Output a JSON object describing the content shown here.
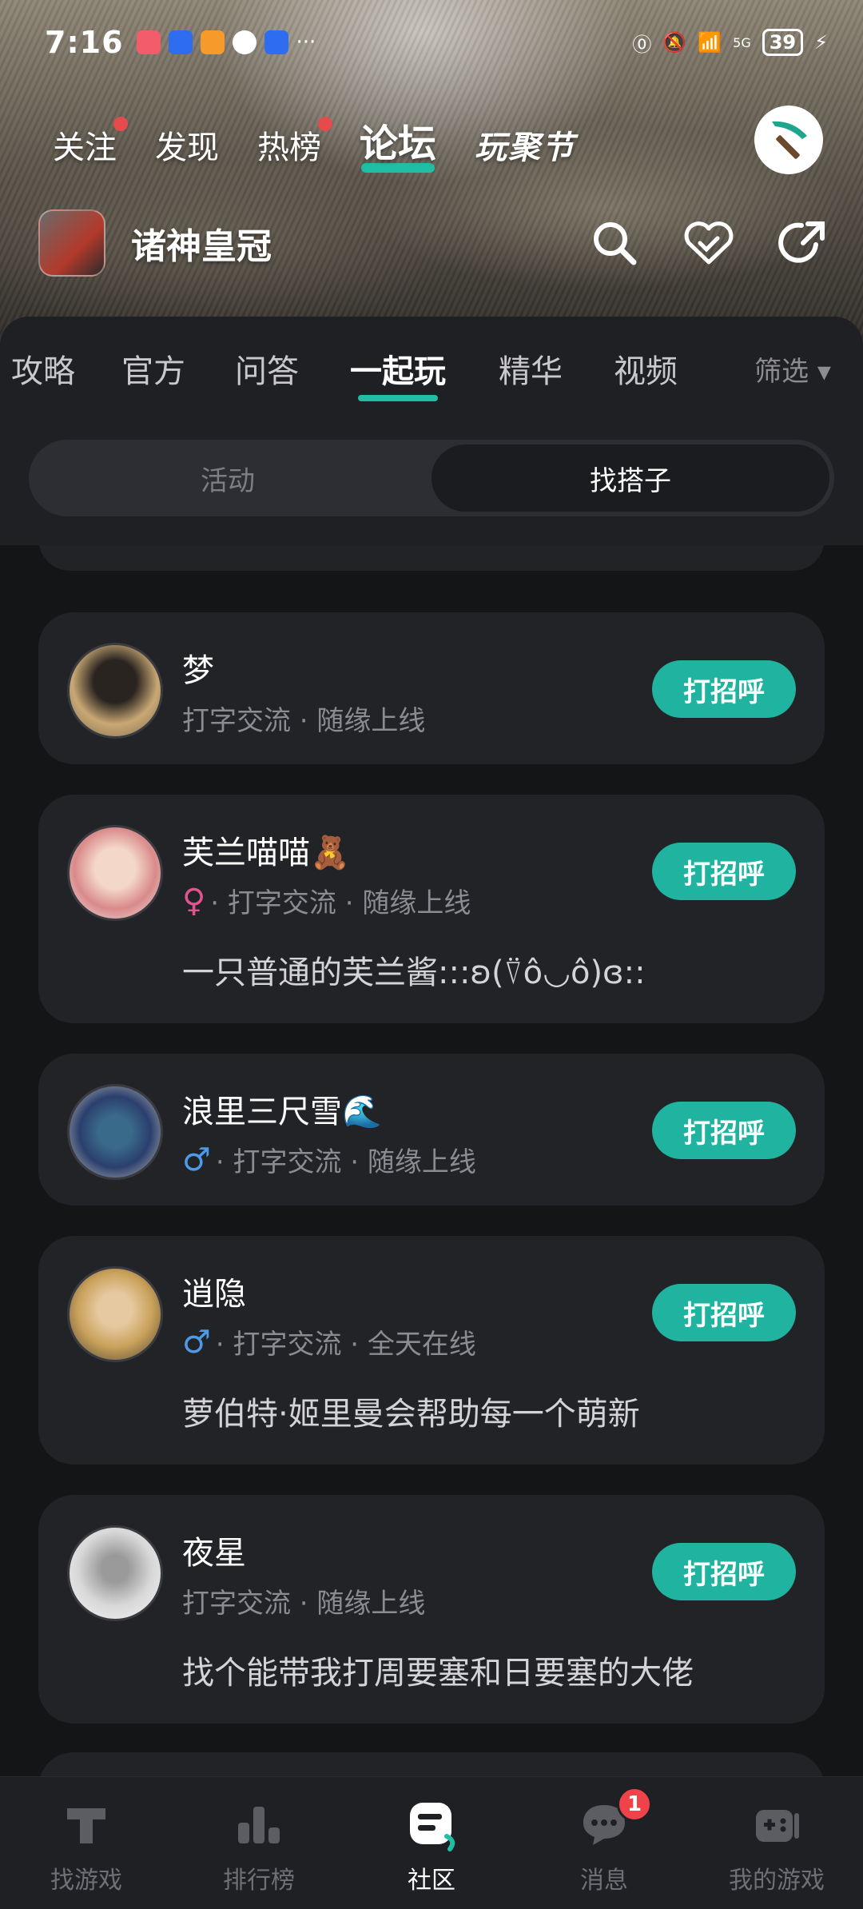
{
  "status_bar": {
    "time": "7:16",
    "battery": "39",
    "network": "5G"
  },
  "top_nav": {
    "items": [
      {
        "label": "关注",
        "dot": true
      },
      {
        "label": "发现",
        "dot": false
      },
      {
        "label": "热榜",
        "dot": true
      },
      {
        "label": "论坛",
        "dot": false,
        "active": true
      }
    ],
    "festival": "玩聚节"
  },
  "game": {
    "name": "诸神皇冠"
  },
  "tabs": {
    "items": [
      "攻略",
      "官方",
      "问答",
      "一起玩",
      "精华",
      "视频"
    ],
    "active": "一起玩",
    "filter": "筛选 ▾"
  },
  "segment": {
    "options": [
      "活动",
      "找搭子"
    ],
    "selected": "找搭子"
  },
  "players": [
    {
      "name": "梦",
      "gender": "",
      "meta": "打字交流 · 随缘上线",
      "bio": "",
      "button": "打招呼"
    },
    {
      "name": "芙兰喵喵🧸",
      "gender": "♀",
      "meta": "· 打字交流 · 随缘上线",
      "bio": "一只普通的芙兰酱:::ʚ(⍢ô◡ô)ɞ::",
      "button": "打招呼"
    },
    {
      "name": "浪里三尺雪🌊",
      "gender": "♂",
      "meta": "· 打字交流 · 随缘上线",
      "bio": "",
      "button": "打招呼"
    },
    {
      "name": "逍隐",
      "gender": "♂",
      "meta": "· 打字交流 · 全天在线",
      "bio": "萝伯特·姬里曼会帮助每一个萌新",
      "button": "打招呼"
    },
    {
      "name": "夜星",
      "gender": "",
      "meta": "打字交流 · 随缘上线",
      "bio": "找个能带我打周要塞和日要塞的大佬",
      "button": "打招呼"
    }
  ],
  "bottom_nav": {
    "items": [
      {
        "label": "找游戏"
      },
      {
        "label": "排行榜"
      },
      {
        "label": "社区",
        "active": true
      },
      {
        "label": "消息",
        "badge": "1"
      },
      {
        "label": "我的游戏"
      }
    ]
  }
}
